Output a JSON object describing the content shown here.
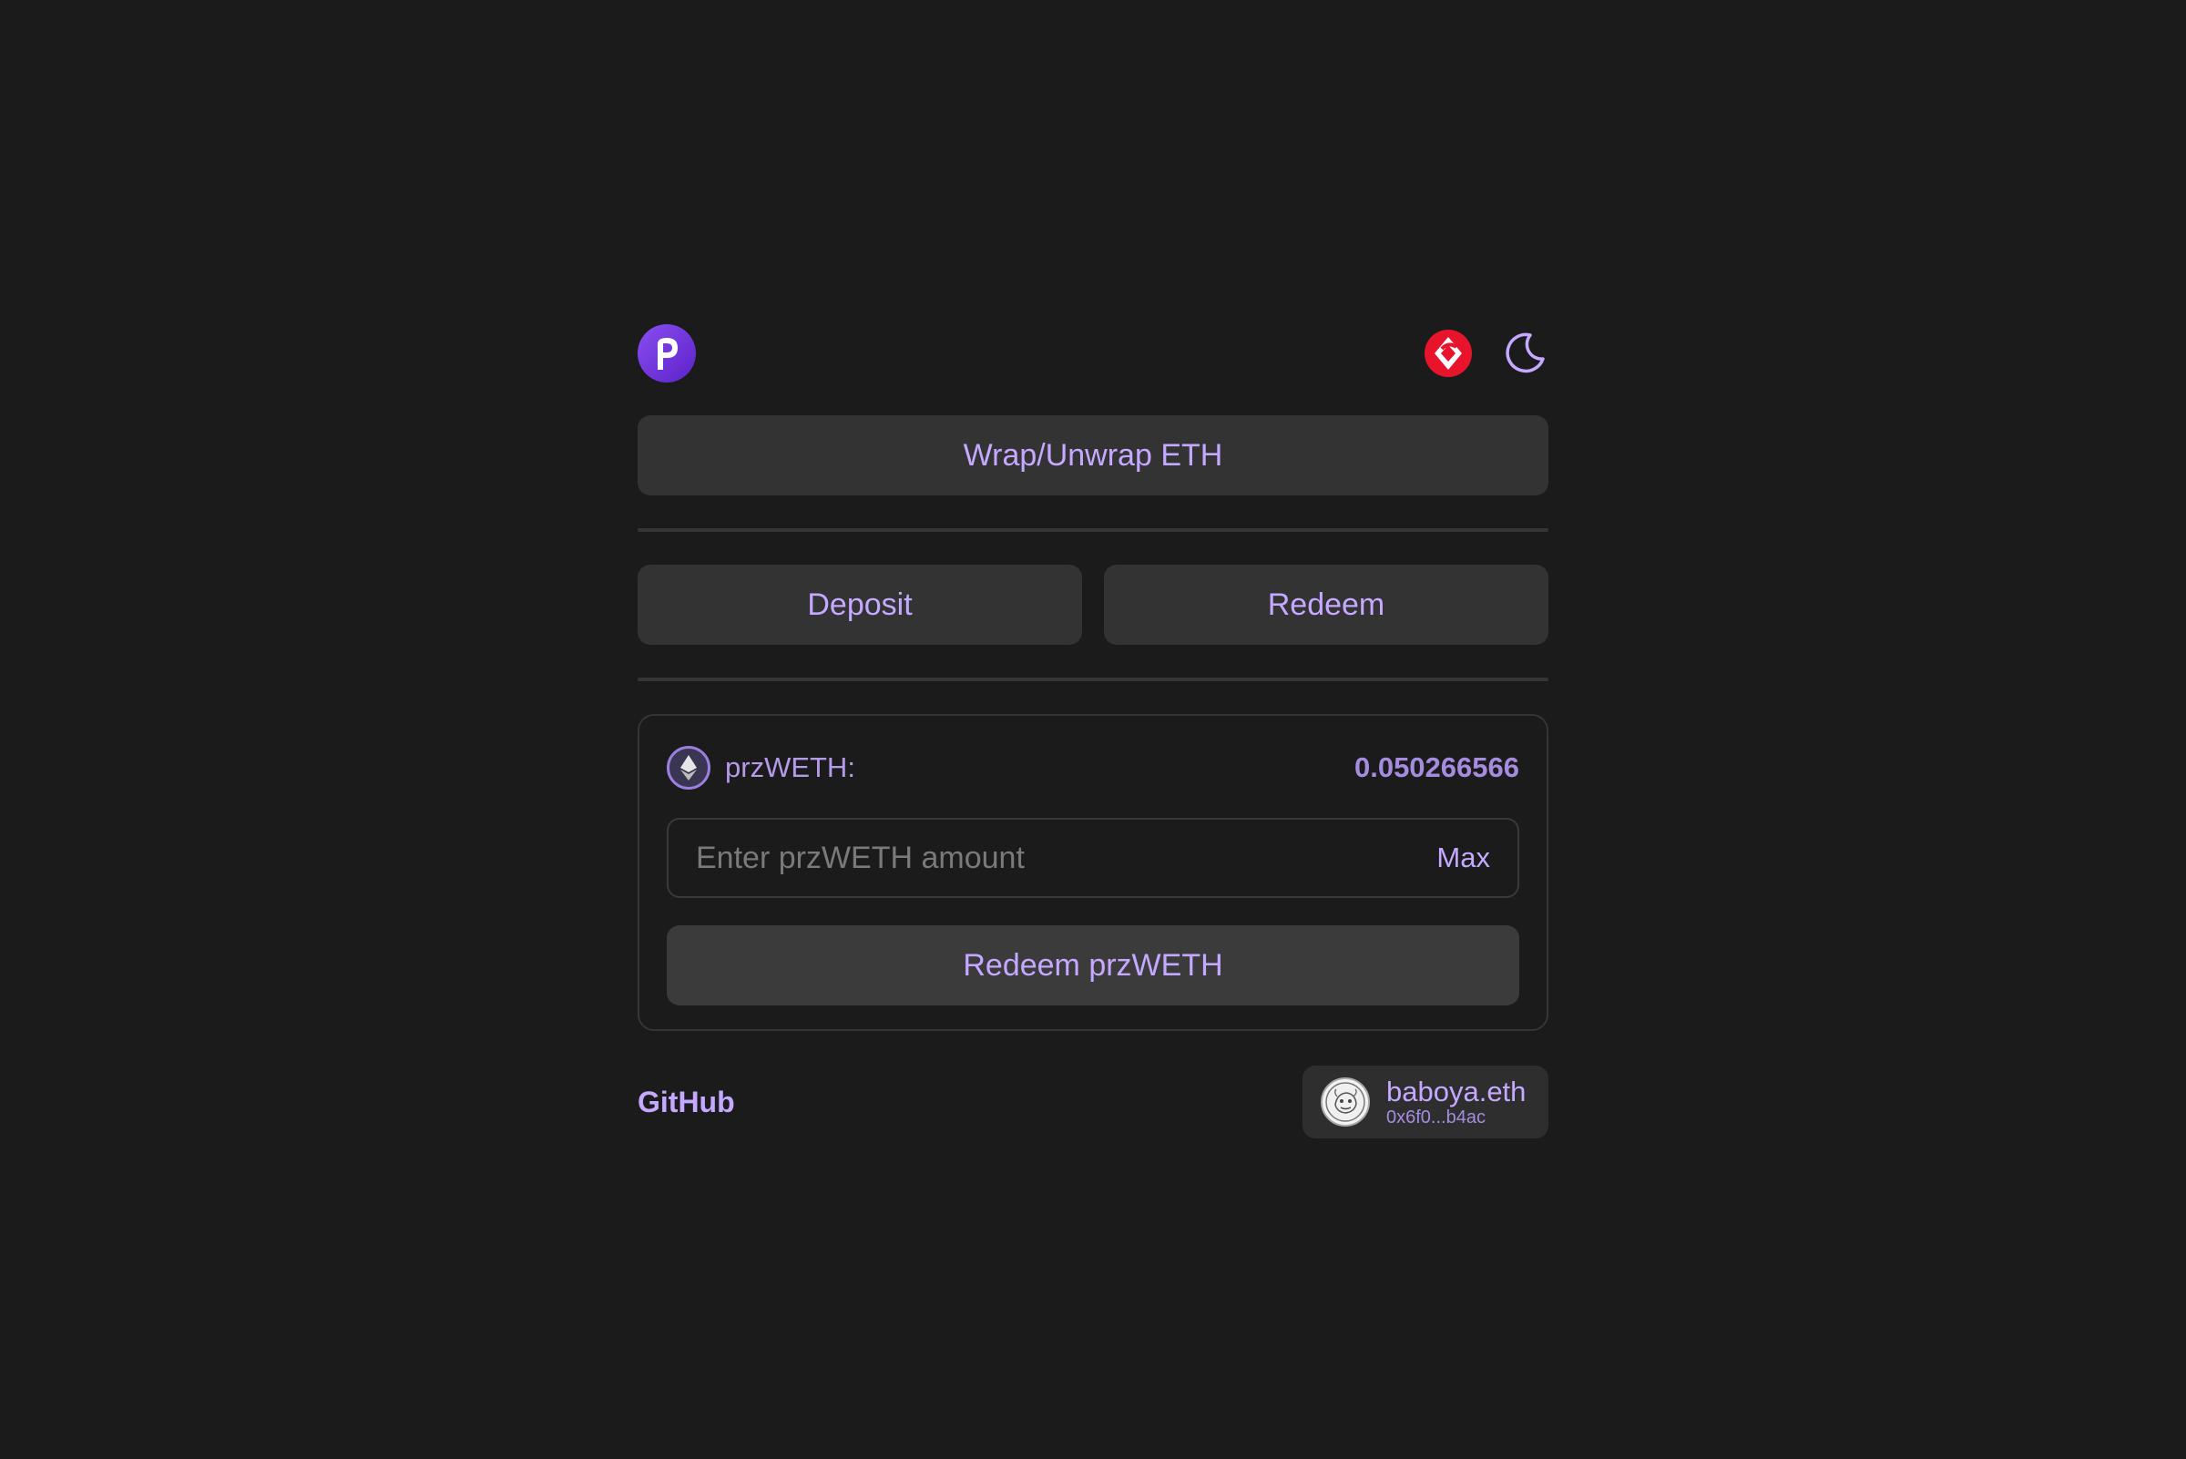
{
  "header": {
    "logo_icon": "purple-p-logo-icon",
    "network_icon": "red-network-icon",
    "theme_icon": "moon-icon"
  },
  "actions": {
    "wrap_label": "Wrap/Unwrap ETH",
    "deposit_label": "Deposit",
    "redeem_tab_label": "Redeem"
  },
  "panel": {
    "token_label": "przWETH:",
    "balance": "0.050266566",
    "amount_placeholder": "Enter przWETH amount",
    "amount_value": "",
    "max_label": "Max",
    "submit_label": "Redeem przWETH"
  },
  "footer": {
    "github_label": "GitHub",
    "account_name": "baboya.eth",
    "account_address": "0x6f0...b4ac"
  },
  "colors": {
    "background": "#1b1b1b",
    "button": "#333333",
    "accent": "#c5a8ff",
    "logo": "#7a3fe4",
    "network": "#e8142c"
  }
}
